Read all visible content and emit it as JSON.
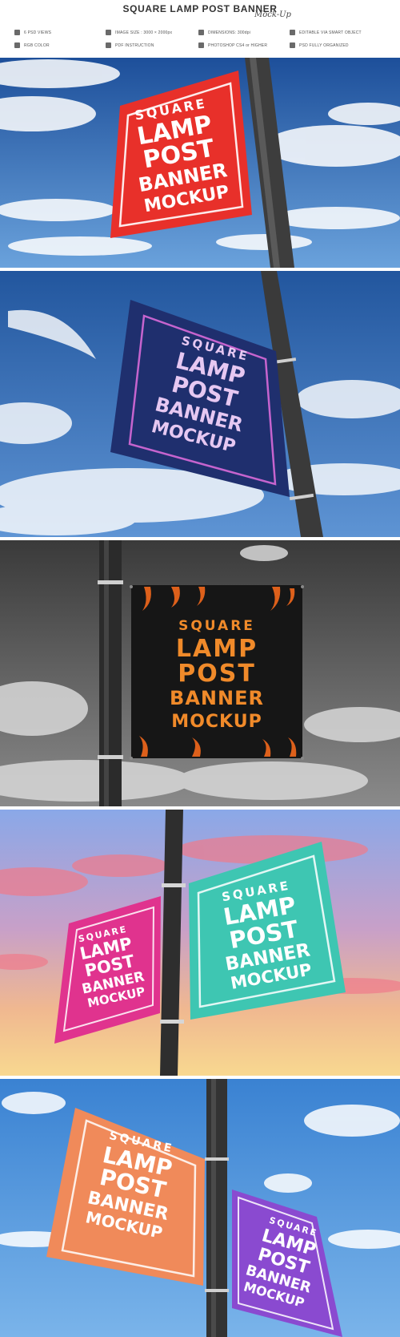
{
  "header": {
    "title": "SQUARE LAMP POST BANNER",
    "script_tag": "Mock-Up",
    "features": [
      "6 PSD VIEWS",
      "IMAGE SIZE : 3000 × 2000px",
      "DIMENSIONS: 300dpi",
      "EDITABLE VIA SMART OBJECT",
      "RGB COLOR",
      "PDF INSTRUCTION",
      "PHOTOSHOP CS4 or HIGHER",
      "PSD FULLY ORGANIZED"
    ]
  },
  "banner": {
    "line1": "SQUARE",
    "line2": "LAMP",
    "line3": "POST",
    "line4": "BANNER",
    "line5": "MOCKUP"
  },
  "colors": {
    "sky_blue": "#3f7fc8",
    "red_banner": "#e8302a",
    "navy_banner": "#1f2f6e",
    "black_banner": "#161616",
    "orange_text": "#f08a2a",
    "pink_banner": "#e0338e",
    "teal_banner": "#3ec6b2",
    "coral_banner": "#f08a5a",
    "purple_banner": "#8a4ad0",
    "pole": "#3a3a3a"
  }
}
